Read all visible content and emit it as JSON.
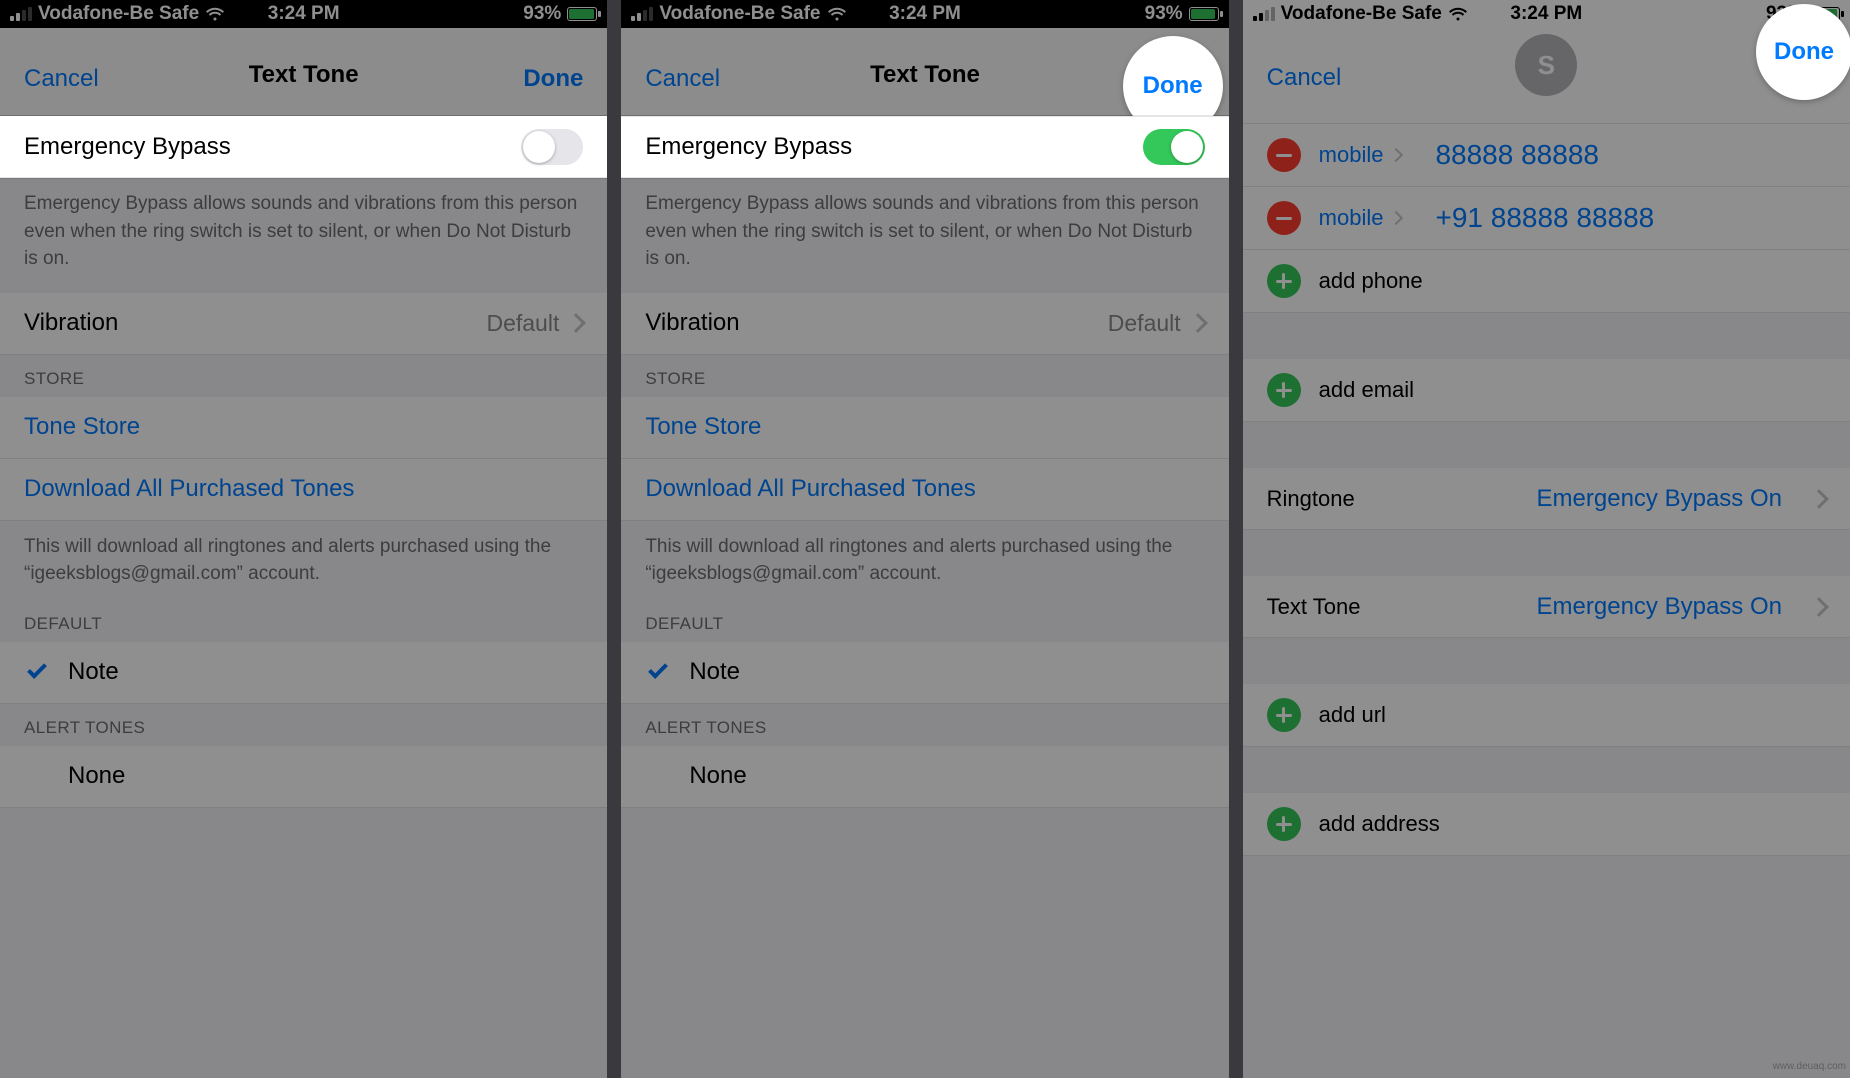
{
  "status": {
    "carrier": "Vodafone-Be Safe",
    "time": "3:24 PM",
    "battery": "93%"
  },
  "s1": {
    "nav": {
      "cancel": "Cancel",
      "title": "Text Tone",
      "done": "Done"
    },
    "emergency_label": "Emergency Bypass",
    "emergency_footnote": "Emergency Bypass allows sounds and vibrations from this person even when the ring switch is set to silent, or when Do Not Disturb is on.",
    "vibration_label": "Vibration",
    "vibration_value": "Default",
    "store_header": "STORE",
    "tone_store": "Tone Store",
    "download_all": "Download All Purchased Tones",
    "download_footnote": "This will download all ringtones and alerts purchased using the “igeeksblogs@gmail.com” account.",
    "default_header": "DEFAULT",
    "note": "Note",
    "alert_header": "ALERT TONES",
    "none": "None"
  },
  "s3": {
    "cancel": "Cancel",
    "done": "Done",
    "avatar": "S",
    "rows": {
      "mobile_label": "mobile",
      "phone1": "88888 88888",
      "phone2": "+91 88888 88888",
      "add_phone": "add phone",
      "add_email": "add email",
      "ringtone_label": "Ringtone",
      "ringtone_value": "Emergency Bypass On",
      "texttone_label": "Text Tone",
      "texttone_value": "Emergency Bypass On",
      "add_url": "add url",
      "add_address": "add address"
    }
  },
  "watermark": "www.deuaq.com"
}
